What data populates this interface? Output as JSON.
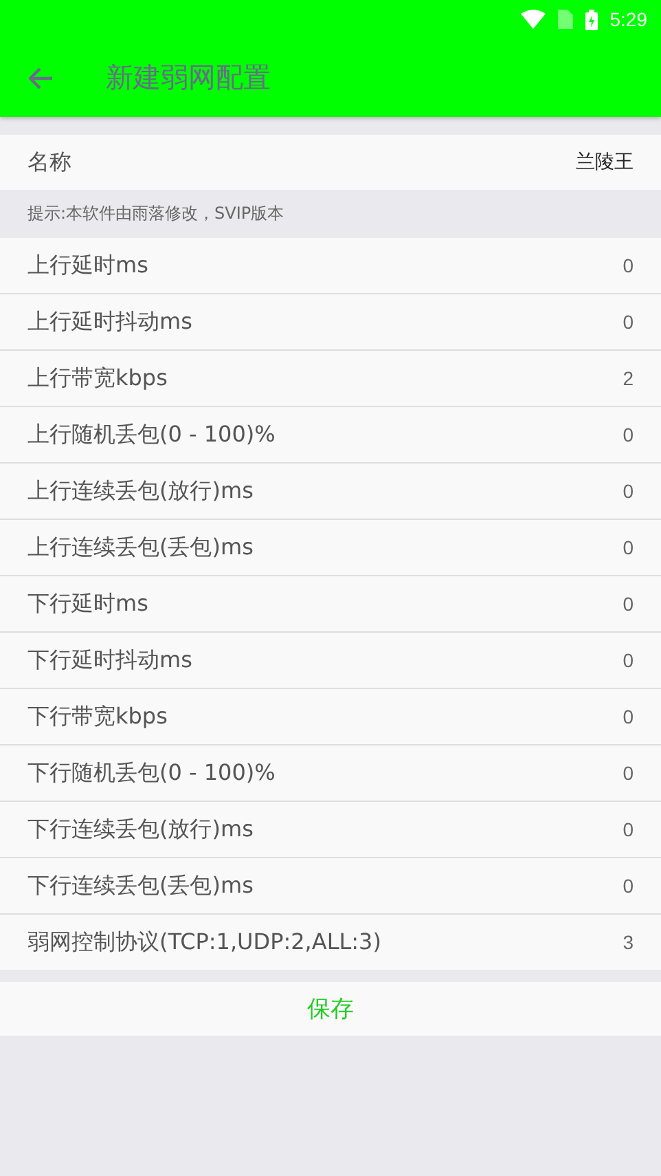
{
  "status_bar": {
    "time": "5:29"
  },
  "toolbar": {
    "title": "新建弱网配置"
  },
  "name_row": {
    "label": "名称",
    "value": "兰陵王"
  },
  "hint": "提示:本软件由雨落修改，SVIP版本",
  "rows": [
    {
      "label": "上行延时ms",
      "value": "0"
    },
    {
      "label": "上行延时抖动ms",
      "value": "0"
    },
    {
      "label": "上行带宽kbps",
      "value": "2"
    },
    {
      "label": "上行随机丢包(0 - 100)%",
      "value": "0"
    },
    {
      "label": "上行连续丢包(放行)ms",
      "value": "0"
    },
    {
      "label": "上行连续丢包(丢包)ms",
      "value": "0"
    },
    {
      "label": "下行延时ms",
      "value": "0"
    },
    {
      "label": "下行延时抖动ms",
      "value": "0"
    },
    {
      "label": "下行带宽kbps",
      "value": "0"
    },
    {
      "label": "下行随机丢包(0 - 100)%",
      "value": "0"
    },
    {
      "label": "下行连续丢包(放行)ms",
      "value": "0"
    },
    {
      "label": "下行连续丢包(丢包)ms",
      "value": "0"
    },
    {
      "label": "弱网控制协议(TCP:1,UDP:2,ALL:3)",
      "value": "3"
    }
  ],
  "save_button": "保存"
}
